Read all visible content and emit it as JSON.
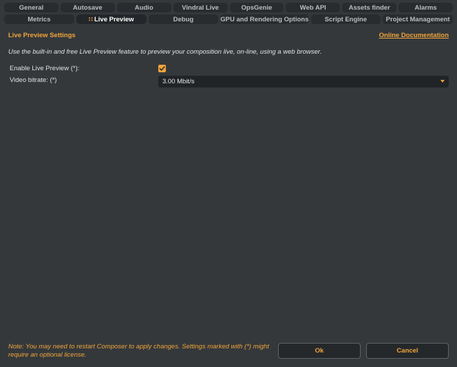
{
  "tabs_row1": [
    {
      "label": "General",
      "active": false
    },
    {
      "label": "Autosave",
      "active": false
    },
    {
      "label": "Audio",
      "active": false
    },
    {
      "label": "Vindral Live",
      "active": false
    },
    {
      "label": "OpsGenie",
      "active": false
    },
    {
      "label": "Web API",
      "active": false
    },
    {
      "label": "Assets finder",
      "active": false
    },
    {
      "label": "Alarms",
      "active": false
    }
  ],
  "tabs_row2": [
    {
      "label": "Metrics",
      "active": false
    },
    {
      "label": "Live Preview",
      "active": true
    },
    {
      "label": "Debug",
      "active": false
    },
    {
      "label": "GPU and Rendering Options",
      "active": false
    },
    {
      "label": "Script Engine",
      "active": false
    },
    {
      "label": "Project Management",
      "active": false
    }
  ],
  "section": {
    "title": "Live Preview Settings",
    "doc_link": "Online Documentation",
    "description": "Use the built-in and free Live Preview feature to preview your composition live, on-line, using a web browser."
  },
  "fields": {
    "enable_label": "Enable Live Preview (*):",
    "enable_checked": true,
    "bitrate_label": "Video bitrate: (*)",
    "bitrate_value": "3.00 Mbit/s"
  },
  "footer": {
    "note": "Note: You may need to restart Composer to apply changes. Settings marked with (*) might require an optional license.",
    "ok_label": "Ok",
    "cancel_label": "Cancel"
  },
  "colors": {
    "accent": "#f0a43a",
    "background": "#34383b",
    "tab_bg": "#292c2e"
  }
}
